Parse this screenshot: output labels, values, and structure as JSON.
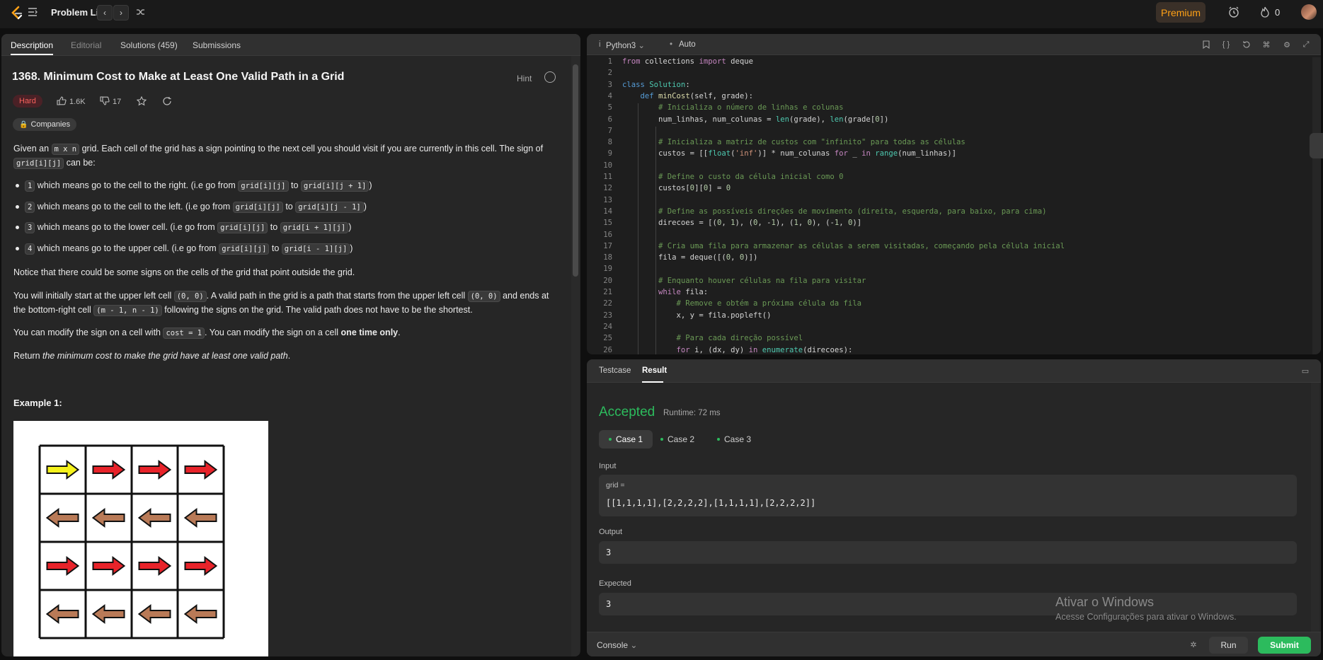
{
  "topbar": {
    "problem_list": "Problem List",
    "premium": "Premium",
    "streak_count": "0"
  },
  "left": {
    "tabs": [
      {
        "label": "Description"
      },
      {
        "label": "Editorial"
      },
      {
        "label": "Solutions (459)"
      },
      {
        "label": "Submissions"
      }
    ],
    "title": "1368. Minimum Cost to Make at Least One Valid Path in a Grid",
    "hint": "Hint",
    "difficulty": "Hard",
    "likes": "1.6K",
    "dislikes": "17",
    "companies": "Companies",
    "p1_a": "Given an ",
    "p1_code1": "m x n",
    "p1_b": " grid. Each cell of the grid has a sign pointing to the next cell you should visit if you are currently in this cell. The sign of ",
    "p1_code2": "grid[i][j]",
    "p1_c": " can be:",
    "bullets": [
      {
        "num": "1",
        "text": " which means go to the cell to the right. (i.e go from ",
        "from": "grid[i][j]",
        "to_word": " to ",
        "to": "grid[i][j + 1]",
        "end": ")"
      },
      {
        "num": "2",
        "text": " which means go to the cell to the left. (i.e go from ",
        "from": "grid[i][j]",
        "to_word": " to ",
        "to": "grid[i][j - 1]",
        "end": ")"
      },
      {
        "num": "3",
        "text": " which means go to the lower cell. (i.e go from ",
        "from": "grid[i][j]",
        "to_word": " to ",
        "to": "grid[i + 1][j]",
        "end": ")"
      },
      {
        "num": "4",
        "text": " which means go to the upper cell. (i.e go from ",
        "from": "grid[i][j]",
        "to_word": " to ",
        "to": "grid[i - 1][j]",
        "end": ")"
      }
    ],
    "p2": "Notice that there could be some signs on the cells of the grid that point outside the grid.",
    "p3_a": "You will initially start at the upper left cell ",
    "p3_code1": "(0, 0)",
    "p3_b": ". A valid path in the grid is a path that starts from the upper left cell ",
    "p3_code2": "(0, 0)",
    "p3_c": " and ends at the bottom-right cell ",
    "p3_code3": "(m - 1, n - 1)",
    "p3_d": " following the signs on the grid. The valid path does not have to be the shortest.",
    "p4_a": "You can modify the sign on a cell with ",
    "p4_code": "cost = 1",
    "p4_b": ". You can modify the sign on a cell ",
    "p4_bold": "one time only",
    "p4_c": ".",
    "p5_a": "Return ",
    "p5_em": "the minimum cost to make the grid have at least one valid path",
    "p5_b": ".",
    "example_title": "Example 1:",
    "example_grid": [
      [
        1,
        1,
        1,
        1
      ],
      [
        2,
        2,
        2,
        2
      ],
      [
        1,
        1,
        1,
        1
      ],
      [
        2,
        2,
        2,
        2
      ]
    ]
  },
  "editor": {
    "language": "Python3",
    "mode": "Auto",
    "lines": [
      "from collections import deque",
      "",
      "class Solution:",
      "    def minCost(self, grade):",
      "        # Inicializa o número de linhas e colunas",
      "        num_linhas, num_colunas = len(grade), len(grade[0])",
      "",
      "        # Inicializa a matriz de custos com \"infinito\" para todas as células",
      "        custos = [[float('inf')] * num_colunas for _ in range(num_linhas)]",
      "",
      "        # Define o custo da célula inicial como 0",
      "        custos[0][0] = 0",
      "",
      "        # Define as possíveis direções de movimento (direita, esquerda, para baixo, para cima)",
      "        direcoes = [(0, 1), (0, -1), (1, 0), (-1, 0)]",
      "",
      "        # Cria uma fila para armazenar as células a serem visitadas, começando pela célula inicial",
      "        fila = deque([(0, 0)])",
      "",
      "        # Enquanto houver células na fila para visitar",
      "        while fila:",
      "            # Remove e obtém a próxima célula da fila",
      "            x, y = fila.popleft()",
      "",
      "            # Para cada direção possível",
      "            for i, (dx, dy) in enumerate(direcoes):"
    ]
  },
  "result": {
    "tabs": [
      {
        "label": "Testcase"
      },
      {
        "label": "Result"
      }
    ],
    "status": "Accepted",
    "runtime": "Runtime: 72 ms",
    "cases": [
      {
        "label": "Case 1"
      },
      {
        "label": "Case 2"
      },
      {
        "label": "Case 3"
      }
    ],
    "input_label": "Input",
    "input_var": "grid =",
    "input_value": "[[1,1,1,1],[2,2,2,2],[1,1,1,1],[2,2,2,2]]",
    "output_label": "Output",
    "output_value": "3",
    "expected_label": "Expected",
    "expected_value": "3",
    "console": "Console",
    "run": "Run",
    "submit": "Submit"
  },
  "watermark": {
    "title": "Ativar o Windows",
    "sub": "Acesse Configurações para ativar o Windows."
  },
  "colors": {
    "accent": "#ffa116",
    "success": "#2cbb5d",
    "hard": "#f8615c"
  }
}
